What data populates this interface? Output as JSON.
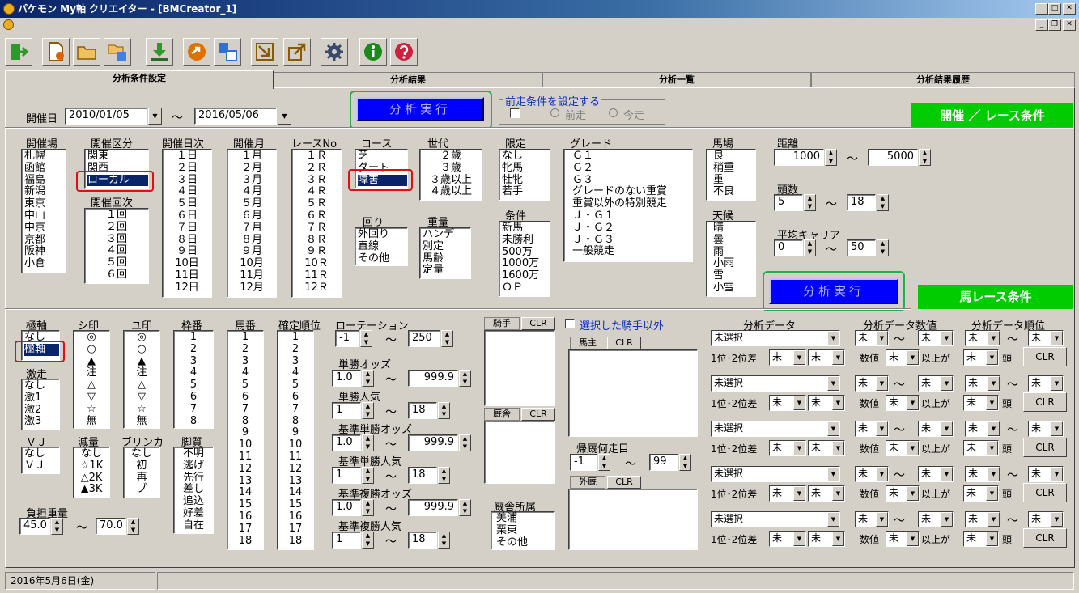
{
  "window": {
    "title": "パケモン My軸 クリエイター - [BMCreator_1]"
  },
  "tabs": [
    "分析条件設定",
    "分析結果",
    "分析一覧",
    "分析結果履歴"
  ],
  "kaisaibi": {
    "label": "開催日",
    "from": "2010/01/05",
    "to": "2016/05/06",
    "tilde": "〜"
  },
  "exec_label": "分析実行",
  "zenso": {
    "label": "前走条件を設定する",
    "opt1": "前走",
    "opt2": "今走"
  },
  "green_race": "開催 ／ レース条件",
  "green_horse": "馬レース条件",
  "lists": {
    "kaisaijo": {
      "label": "開催場",
      "items": [
        "札幌",
        "函館",
        "福島",
        "新潟",
        "東京",
        "中山",
        "中京",
        "京都",
        "阪神",
        "小倉"
      ]
    },
    "kubun": {
      "label": "開催区分",
      "items": [
        "関東",
        "関西",
        "ローカル"
      ]
    },
    "kaiji": {
      "label": "開催回次",
      "items": [
        "１回",
        "２回",
        "３回",
        "４回",
        "５回",
        "６回"
      ]
    },
    "nichiji": {
      "label": "開催日次",
      "items": [
        "１日",
        "２日",
        "３日",
        "４日",
        "５日",
        "６日",
        "７日",
        "８日",
        "９日",
        "10日",
        "11日",
        "12日"
      ]
    },
    "tsuki": {
      "label": "開催月",
      "items": [
        "１月",
        "２月",
        "３月",
        "４月",
        "５月",
        "６月",
        "７月",
        "８月",
        "９月",
        "10月",
        "11月",
        "12月"
      ]
    },
    "raceno": {
      "label": "レースNo",
      "items": [
        "１Ｒ",
        "２Ｒ",
        "３Ｒ",
        "４Ｒ",
        "５Ｒ",
        "６Ｒ",
        "７Ｒ",
        "８Ｒ",
        "９Ｒ",
        "10Ｒ",
        "11Ｒ",
        "12Ｒ"
      ]
    },
    "course": {
      "label": "コース",
      "items": [
        "芝",
        "ダート",
        "障害"
      ]
    },
    "mawari": {
      "label": "回り",
      "items": [
        "外回り",
        "直線",
        "その他"
      ]
    },
    "sedai": {
      "label": "世代",
      "items": [
        "２歳",
        "３歳",
        "３歳以上",
        "４歳以上"
      ]
    },
    "juryo": {
      "label": "重量",
      "items": [
        "ハンデ",
        "別定",
        "馬齢",
        "定量"
      ]
    },
    "gentei": {
      "label": "限定",
      "items": [
        "なし",
        "牝馬",
        "牡牝",
        "若手"
      ]
    },
    "joken": {
      "label": "条件",
      "items": [
        "新馬",
        "未勝利",
        "500万",
        "1000万",
        "1600万",
        "ＯＰ"
      ]
    },
    "grade": {
      "label": "グレード",
      "items": [
        "Ｇ１",
        "Ｇ２",
        "Ｇ３",
        "グレードのない重賞",
        "重賞以外の特別競走",
        "Ｊ・Ｇ１",
        "Ｊ・Ｇ２",
        "Ｊ・Ｇ３",
        "一般競走"
      ]
    },
    "baba": {
      "label": "馬場",
      "items": [
        "良",
        "稍重",
        "重",
        "不良"
      ]
    },
    "tenko": {
      "label": "天候",
      "items": [
        "晴",
        "曇",
        "雨",
        "小雨",
        "雪",
        "小雪"
      ]
    },
    "kyokujiku": {
      "label": "極軸",
      "items": [
        "なし",
        "極軸"
      ]
    },
    "shirushi": {
      "label": "シ印",
      "items": [
        "◎",
        "○",
        "▲",
        "注",
        "△",
        "▽",
        "☆",
        "無"
      ]
    },
    "yujirushi": {
      "label": "ユ印",
      "items": [
        "◎",
        "○",
        "▲",
        "注",
        "△",
        "▽",
        "☆",
        "無"
      ]
    },
    "wakuban": {
      "label": "枠番",
      "items": [
        "1",
        "2",
        "3",
        "4",
        "5",
        "6",
        "7",
        "8"
      ]
    },
    "umaban": {
      "label": "馬番",
      "items": [
        "1",
        "2",
        "3",
        "4",
        "5",
        "6",
        "7",
        "8",
        "9",
        "10",
        "11",
        "12",
        "13",
        "14",
        "15",
        "16",
        "17",
        "18"
      ]
    },
    "kakutei": {
      "label": "確定順位",
      "items": [
        "1",
        "2",
        "3",
        "4",
        "5",
        "6",
        "7",
        "8",
        "9",
        "10",
        "11",
        "12",
        "13",
        "14",
        "15",
        "16",
        "17",
        "18"
      ]
    },
    "gekiso": {
      "label": "激走",
      "items": [
        "なし",
        "激1",
        "激2",
        "激3"
      ]
    },
    "vj": {
      "label": "ＶＪ",
      "items": [
        "なし",
        "ＶＪ"
      ]
    },
    "genryo": {
      "label": "減量",
      "items": [
        "なし",
        "☆1K",
        "△2K",
        "▲3K"
      ]
    },
    "blinker": {
      "label": "ブリンカ",
      "items": [
        "なし",
        "初",
        "再",
        "ブ"
      ]
    },
    "kyakushitsu": {
      "label": "脚質",
      "items": [
        "不明",
        "逃げ",
        "先行",
        "差し",
        "追込",
        "好差",
        "自在"
      ]
    },
    "kyusha": {
      "label": "厩舎所属",
      "items": [
        "美浦",
        "栗東",
        "その他"
      ]
    }
  },
  "kyori": {
    "label": "距離",
    "from": "1000",
    "to": "5000"
  },
  "tosu": {
    "label": "頭数",
    "from": "5",
    "to": "18"
  },
  "career": {
    "label": "平均キャリア",
    "from": "0",
    "to": "50"
  },
  "futan": {
    "label": "負担重量",
    "from": "45.0",
    "to": "70.0"
  },
  "rotation": {
    "label": "ローテーション",
    "from": "-1",
    "to": "250"
  },
  "tansho_odds": {
    "label": "単勝オッズ",
    "from": "1.0",
    "to": "999.9"
  },
  "tansho_ninki": {
    "label": "単勝人気",
    "from": "1",
    "to": "18"
  },
  "kijun_tansho_odds": {
    "label": "基準単勝オッズ",
    "from": "1.0",
    "to": "999.9"
  },
  "kijun_tansho_ninki": {
    "label": "基準単勝人気",
    "from": "1",
    "to": "18"
  },
  "kijun_fukusho_odds": {
    "label": "基準複勝オッズ",
    "from": "1.0",
    "to": "999.9"
  },
  "kijun_fukusho_ninki": {
    "label": "基準複勝人気",
    "from": "1",
    "to": "18"
  },
  "kishu": {
    "label": "騎手",
    "clr": "CLR",
    "except": "選択した騎手以外"
  },
  "banushi": {
    "label": "馬主",
    "clr": "CLR"
  },
  "kyusha_box": {
    "label": "厩舎",
    "clr": "CLR"
  },
  "gaikyu": {
    "label": "外厩",
    "clr": "CLR"
  },
  "kikyu": {
    "label": "帰厩何走目",
    "from": "-1",
    "to": "99"
  },
  "analysis": {
    "h1": "分析データ",
    "h2": "分析データ数値",
    "h3": "分析データ順位",
    "select": "未選択",
    "diff": "1位･2位差",
    "val": "数値",
    "over": "以上が",
    "mi": "未",
    "to": "頭",
    "clr": "CLR",
    "rows": 5
  },
  "status": {
    "date": "2016年5月6日(金)"
  }
}
